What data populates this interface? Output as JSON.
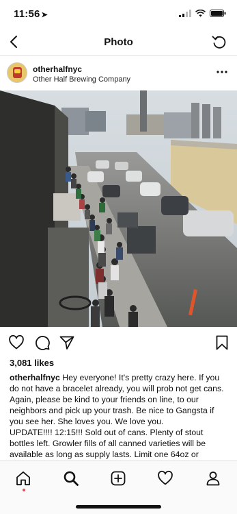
{
  "status_bar": {
    "time": "11:56",
    "location_arrow": "location-arrow-icon",
    "signal": "signal-icon",
    "wifi": "wifi-icon",
    "battery": "battery-icon"
  },
  "nav": {
    "title": "Photo",
    "back_icon": "chevron-left-icon",
    "refresh_icon": "refresh-icon"
  },
  "post": {
    "username": "otherhalfnyc",
    "location": "Other Half Brewing Company",
    "likes": "3,081 likes",
    "caption_user": "otherhalfnyc",
    "caption_text": "Hey everyone! It's pretty crazy here. If you do not have a bracelet already, you will prob not get cans. Again, please be kind to your friends on line, to our neighbors and pick up your trash. Be nice to Gangsta if you see her. She loves you. We love you.",
    "update_text": "UPDATE!!!! 12:15!!! Sold out of cans. Plenty of stout bottles left. Growler fills of all canned varieties will be available as long as supply lasts. Limit one 64oz or"
  },
  "tab_bar": {
    "items": [
      "home-icon",
      "search-icon",
      "new-post-icon",
      "activity-heart-icon",
      "profile-icon"
    ]
  },
  "colors": {
    "accent_red": "#ed4956",
    "divider": "#dbdbdb",
    "text": "#111111"
  }
}
